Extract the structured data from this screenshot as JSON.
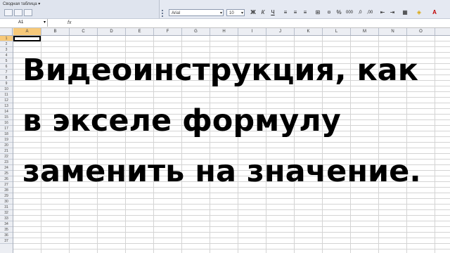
{
  "toolbar": {
    "pivot_label": "Сводная таблица ▾",
    "font_name": "Arial",
    "font_size": "10",
    "bold": "Ж",
    "italic": "К",
    "underline": "Ч",
    "percent": "%",
    "thousands": "000",
    "font_color_icon": "A"
  },
  "formula_bar": {
    "name_box": "A1",
    "fx": "fx"
  },
  "columns": [
    "A",
    "B",
    "C",
    "D",
    "E",
    "F",
    "G",
    "H",
    "I",
    "J",
    "K",
    "L",
    "M",
    "N",
    "O"
  ],
  "rows": [
    "1",
    "2",
    "3",
    "4",
    "5",
    "6",
    "7",
    "8",
    "9",
    "10",
    "11",
    "12",
    "13",
    "14",
    "15",
    "16",
    "17",
    "18",
    "19",
    "20",
    "21",
    "22",
    "23",
    "24",
    "25",
    "26",
    "27",
    "28",
    "29",
    "30",
    "31",
    "32",
    "33",
    "34",
    "35",
    "36",
    "37"
  ],
  "headline": {
    "line1": "Видеоинструкция, как",
    "line2": "в экселе формулу",
    "line3": "заменить на значение."
  },
  "colors": {
    "accent": "#f7c979",
    "toolbar_bg": "#e5e9f2"
  }
}
